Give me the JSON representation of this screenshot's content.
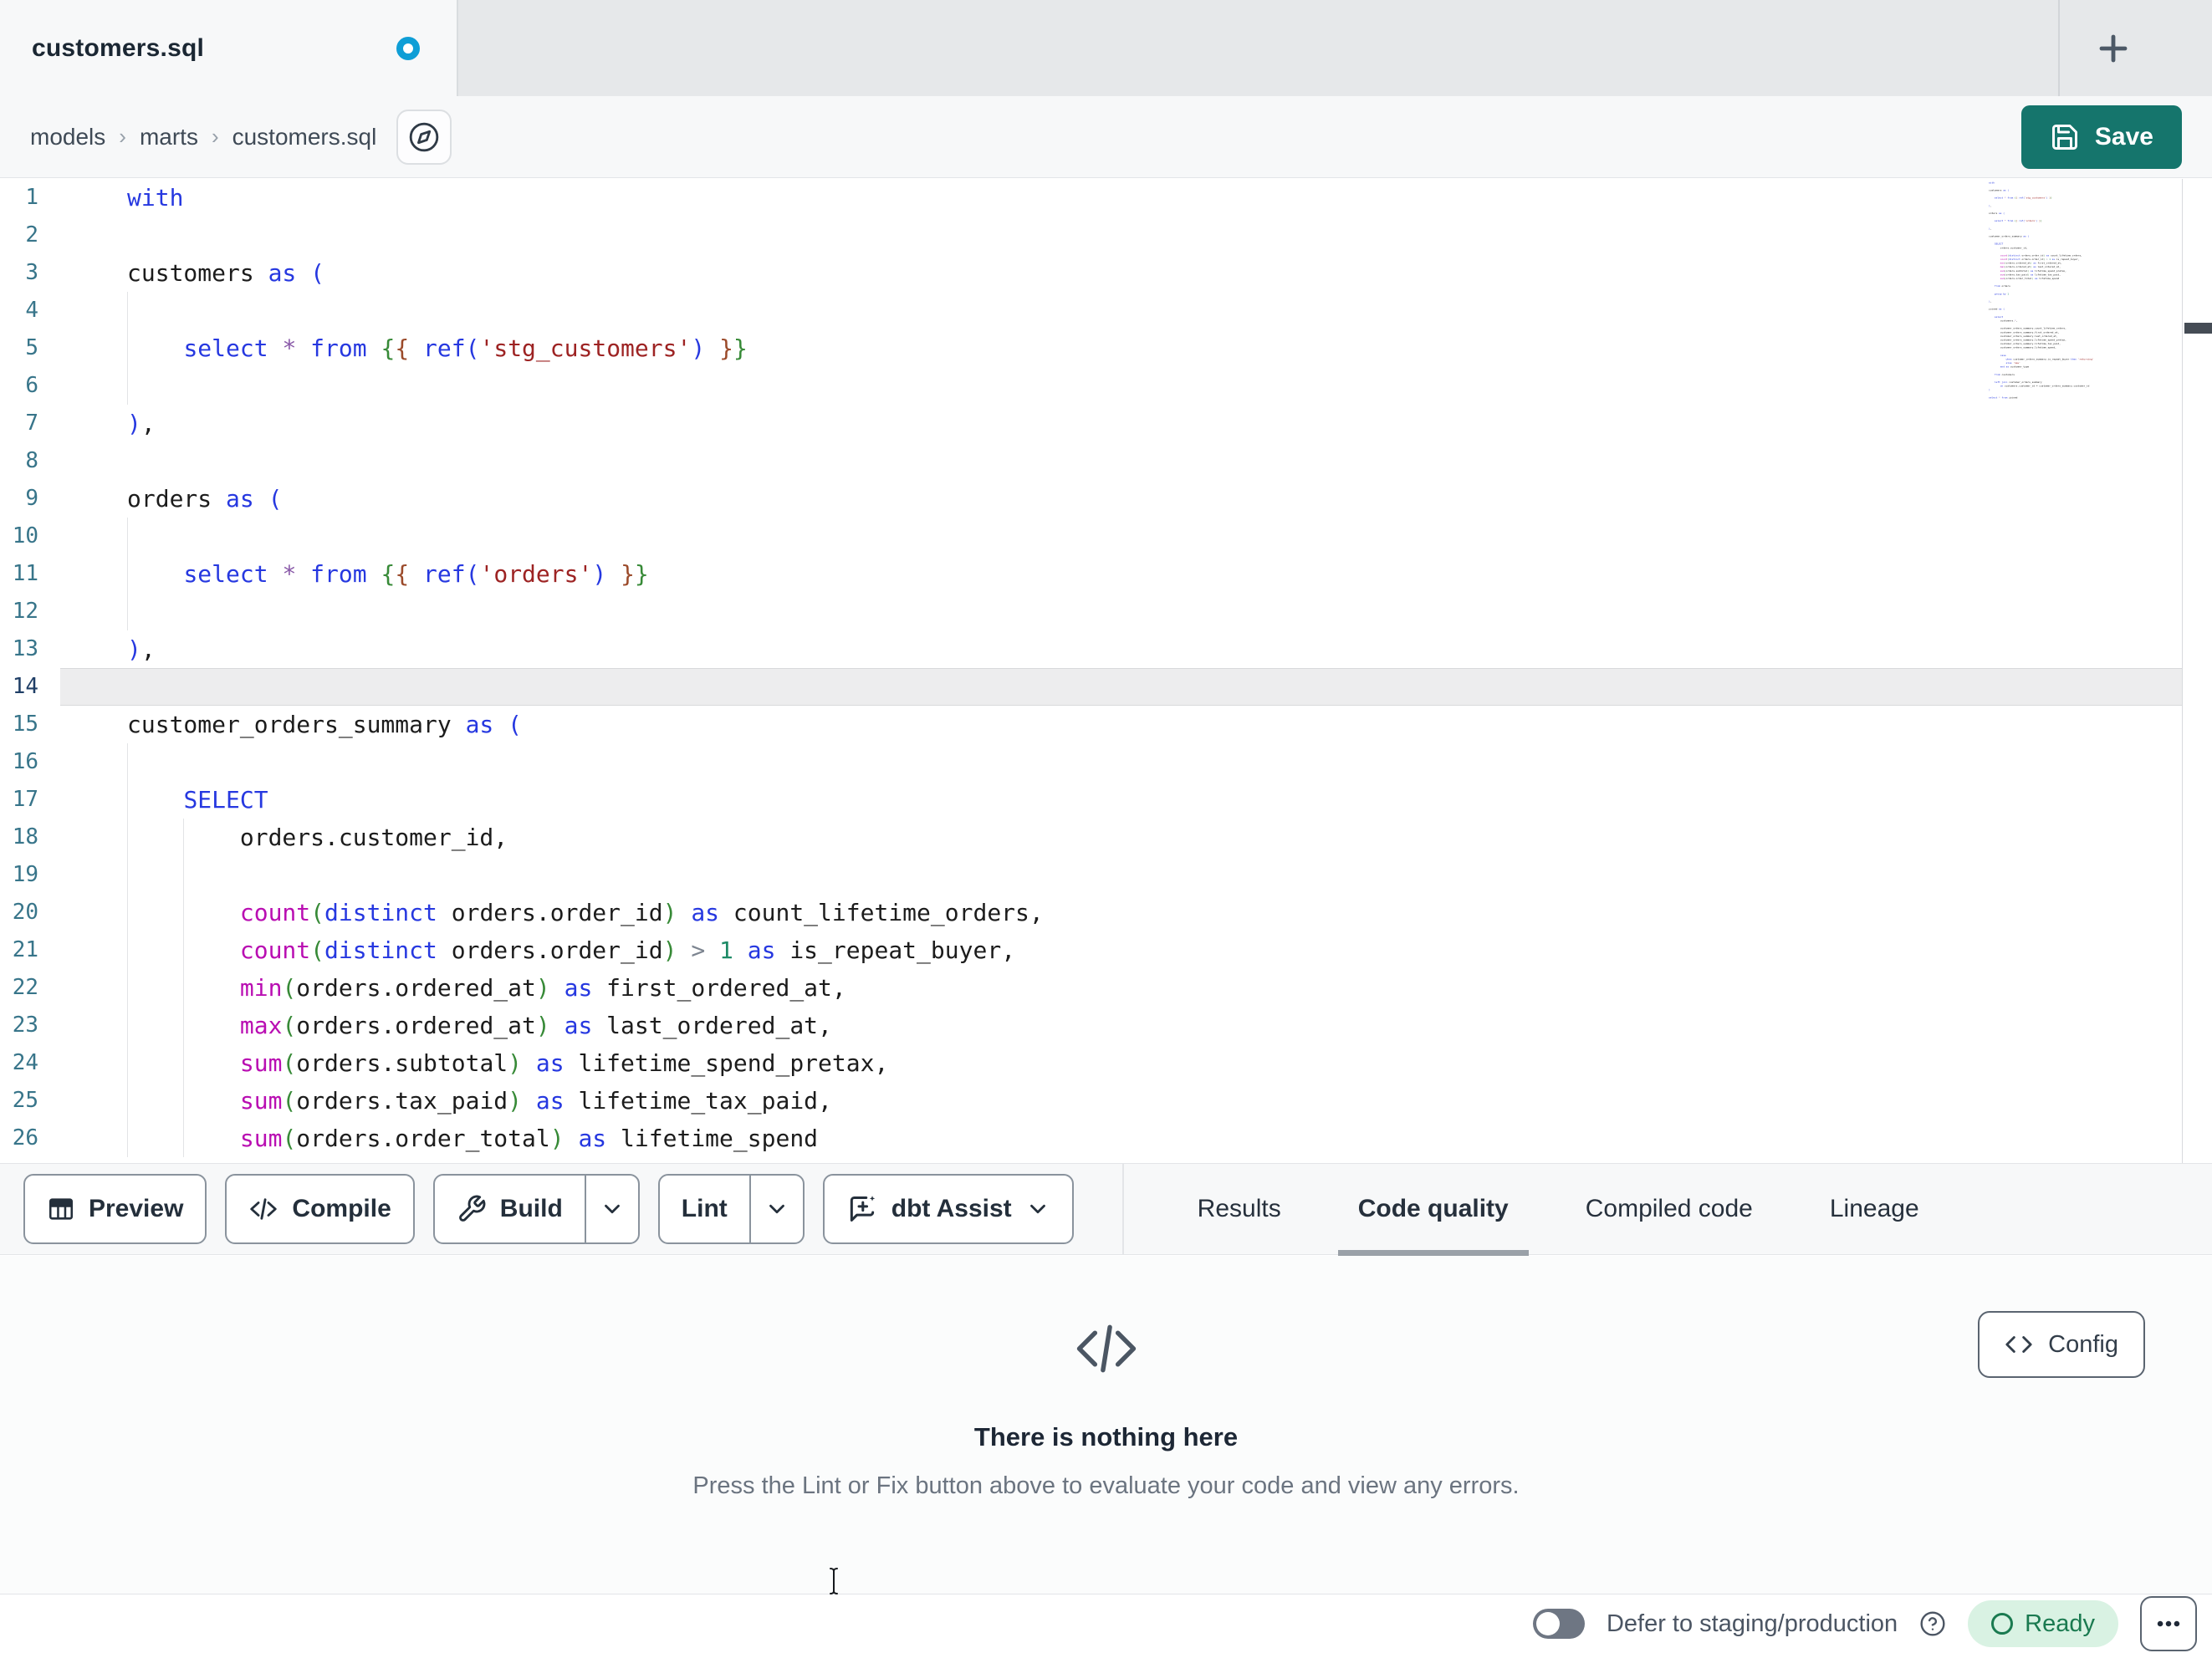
{
  "tab_bar": {
    "active_tab": {
      "title": "customers.sql",
      "unsaved": true,
      "unsaved_icon": "unsaved-dot-icon"
    },
    "new_tab_icon": "plus-icon"
  },
  "breadcrumb": {
    "items": [
      "models",
      "marts",
      "customers.sql"
    ],
    "separator": "›",
    "action_icon": "compass-icon"
  },
  "header": {
    "save_label": "Save",
    "save_icon": "save-icon"
  },
  "editor": {
    "active_line": 14,
    "lines": [
      {
        "n": 1,
        "seg": [
          [
            "kw",
            "with"
          ]
        ]
      },
      {
        "n": 2,
        "seg": []
      },
      {
        "n": 3,
        "seg": [
          [
            "txt",
            "customers "
          ],
          [
            "kw",
            "as"
          ],
          [
            "txt",
            " "
          ],
          [
            "b1",
            "("
          ]
        ]
      },
      {
        "n": 4,
        "seg": [],
        "g": [
          0
        ]
      },
      {
        "n": 5,
        "g": [
          0
        ],
        "seg": [
          [
            "txt",
            "    "
          ],
          [
            "kw",
            "select"
          ],
          [
            "txt",
            " "
          ],
          [
            "star",
            "*"
          ],
          [
            "txt",
            " "
          ],
          [
            "kw",
            "from"
          ],
          [
            "txt",
            " "
          ],
          [
            "b2",
            "{"
          ],
          [
            "b3",
            "{"
          ],
          [
            "txt",
            " "
          ],
          [
            "kw",
            "ref"
          ],
          [
            "b1",
            "("
          ],
          [
            "str",
            "'stg_customers'"
          ],
          [
            "b1",
            ")"
          ],
          [
            "txt",
            " "
          ],
          [
            "b3",
            "}"
          ],
          [
            "b2",
            "}"
          ]
        ]
      },
      {
        "n": 6,
        "seg": [],
        "g": [
          0
        ]
      },
      {
        "n": 7,
        "seg": [
          [
            "b1",
            ")"
          ],
          [
            "txt",
            ","
          ]
        ]
      },
      {
        "n": 8,
        "seg": []
      },
      {
        "n": 9,
        "seg": [
          [
            "txt",
            "orders "
          ],
          [
            "kw",
            "as"
          ],
          [
            "txt",
            " "
          ],
          [
            "b1",
            "("
          ]
        ]
      },
      {
        "n": 10,
        "seg": [],
        "g": [
          0
        ]
      },
      {
        "n": 11,
        "g": [
          0
        ],
        "seg": [
          [
            "txt",
            "    "
          ],
          [
            "kw",
            "select"
          ],
          [
            "txt",
            " "
          ],
          [
            "star",
            "*"
          ],
          [
            "txt",
            " "
          ],
          [
            "kw",
            "from"
          ],
          [
            "txt",
            " "
          ],
          [
            "b2",
            "{"
          ],
          [
            "b3",
            "{"
          ],
          [
            "txt",
            " "
          ],
          [
            "kw",
            "ref"
          ],
          [
            "b1",
            "("
          ],
          [
            "str",
            "'orders'"
          ],
          [
            "b1",
            ")"
          ],
          [
            "txt",
            " "
          ],
          [
            "b3",
            "}"
          ],
          [
            "b2",
            "}"
          ]
        ]
      },
      {
        "n": 12,
        "seg": [],
        "g": [
          0
        ]
      },
      {
        "n": 13,
        "seg": [
          [
            "b1",
            ")"
          ],
          [
            "txt",
            ","
          ]
        ]
      },
      {
        "n": 14,
        "seg": []
      },
      {
        "n": 15,
        "seg": [
          [
            "txt",
            "customer_orders_summary "
          ],
          [
            "kw",
            "as"
          ],
          [
            "txt",
            " "
          ],
          [
            "b1",
            "("
          ]
        ]
      },
      {
        "n": 16,
        "seg": [],
        "g": [
          0
        ]
      },
      {
        "n": 17,
        "g": [
          0
        ],
        "seg": [
          [
            "txt",
            "    "
          ],
          [
            "kw",
            "SELECT"
          ]
        ]
      },
      {
        "n": 18,
        "g": [
          0,
          1
        ],
        "seg": [
          [
            "txt",
            "        orders.customer_id,"
          ]
        ]
      },
      {
        "n": 19,
        "seg": [],
        "g": [
          0,
          1
        ]
      },
      {
        "n": 20,
        "g": [
          0,
          1
        ],
        "seg": [
          [
            "txt",
            "        "
          ],
          [
            "fn",
            "count"
          ],
          [
            "b2",
            "("
          ],
          [
            "kw",
            "distinct"
          ],
          [
            "txt",
            " orders.order_id"
          ],
          [
            "b2",
            ")"
          ],
          [
            "txt",
            " "
          ],
          [
            "kw",
            "as"
          ],
          [
            "txt",
            " count_lifetime_orders,"
          ]
        ]
      },
      {
        "n": 21,
        "g": [
          0,
          1
        ],
        "seg": [
          [
            "txt",
            "        "
          ],
          [
            "fn",
            "count"
          ],
          [
            "b2",
            "("
          ],
          [
            "kw",
            "distinct"
          ],
          [
            "txt",
            " orders.order_id"
          ],
          [
            "b2",
            ")"
          ],
          [
            "txt",
            " "
          ],
          [
            "op",
            ">"
          ],
          [
            "txt",
            " "
          ],
          [
            "num",
            "1"
          ],
          [
            "txt",
            " "
          ],
          [
            "kw",
            "as"
          ],
          [
            "txt",
            " is_repeat_buyer,"
          ]
        ]
      },
      {
        "n": 22,
        "g": [
          0,
          1
        ],
        "seg": [
          [
            "txt",
            "        "
          ],
          [
            "fn",
            "min"
          ],
          [
            "b2",
            "("
          ],
          [
            "txt",
            "orders.ordered_at"
          ],
          [
            "b2",
            ")"
          ],
          [
            "txt",
            " "
          ],
          [
            "kw",
            "as"
          ],
          [
            "txt",
            " first_ordered_at,"
          ]
        ]
      },
      {
        "n": 23,
        "g": [
          0,
          1
        ],
        "seg": [
          [
            "txt",
            "        "
          ],
          [
            "fn",
            "max"
          ],
          [
            "b2",
            "("
          ],
          [
            "txt",
            "orders.ordered_at"
          ],
          [
            "b2",
            ")"
          ],
          [
            "txt",
            " "
          ],
          [
            "kw",
            "as"
          ],
          [
            "txt",
            " last_ordered_at,"
          ]
        ]
      },
      {
        "n": 24,
        "g": [
          0,
          1
        ],
        "seg": [
          [
            "txt",
            "        "
          ],
          [
            "fn",
            "sum"
          ],
          [
            "b2",
            "("
          ],
          [
            "txt",
            "orders.subtotal"
          ],
          [
            "b2",
            ")"
          ],
          [
            "txt",
            " "
          ],
          [
            "kw",
            "as"
          ],
          [
            "txt",
            " lifetime_spend_pretax,"
          ]
        ]
      },
      {
        "n": 25,
        "g": [
          0,
          1
        ],
        "seg": [
          [
            "txt",
            "        "
          ],
          [
            "fn",
            "sum"
          ],
          [
            "b2",
            "("
          ],
          [
            "txt",
            "orders.tax_paid"
          ],
          [
            "b2",
            ")"
          ],
          [
            "txt",
            " "
          ],
          [
            "kw",
            "as"
          ],
          [
            "txt",
            " lifetime_tax_paid,"
          ]
        ]
      },
      {
        "n": 26,
        "g": [
          0,
          1
        ],
        "seg": [
          [
            "txt",
            "        "
          ],
          [
            "fn",
            "sum"
          ],
          [
            "b2",
            "("
          ],
          [
            "txt",
            "orders.order_total"
          ],
          [
            "b2",
            ")"
          ],
          [
            "txt",
            " "
          ],
          [
            "kw",
            "as"
          ],
          [
            "txt",
            " lifetime_spend"
          ]
        ]
      }
    ]
  },
  "minimap_extra_lines": [
    [],
    [
      [
        "txt",
        "    "
      ],
      [
        "kw",
        "from"
      ],
      [
        "txt",
        " orders"
      ]
    ],
    [],
    [
      [
        "txt",
        "    "
      ],
      [
        "kw",
        "group"
      ],
      [
        "txt",
        " "
      ],
      [
        "kw",
        "by"
      ],
      [
        "txt",
        " "
      ],
      [
        "num",
        "1"
      ]
    ],
    [],
    [
      [
        "b1",
        ")"
      ],
      [
        "txt",
        ","
      ]
    ],
    [],
    [
      [
        "txt",
        "joined "
      ],
      [
        "kw",
        "as"
      ],
      [
        "txt",
        " "
      ],
      [
        "b1",
        "("
      ]
    ],
    [],
    [
      [
        "txt",
        "    "
      ],
      [
        "kw",
        "select"
      ]
    ],
    [
      [
        "txt",
        "        customers."
      ],
      [
        "star",
        "*"
      ],
      [
        "txt",
        ","
      ]
    ],
    [],
    [
      [
        "txt",
        "        customer_orders_summary.count_lifetime_orders,"
      ]
    ],
    [
      [
        "txt",
        "        customer_orders_summary.first_ordered_at,"
      ]
    ],
    [
      [
        "txt",
        "        customer_orders_summary.last_ordered_at,"
      ]
    ],
    [
      [
        "txt",
        "        customer_orders_summary.lifetime_spend_pretax,"
      ]
    ],
    [
      [
        "txt",
        "        customer_orders_summary.lifetime_tax_paid,"
      ]
    ],
    [
      [
        "txt",
        "        customer_orders_summary.lifetime_spend,"
      ]
    ],
    [],
    [
      [
        "txt",
        "        "
      ],
      [
        "kw",
        "case"
      ]
    ],
    [
      [
        "txt",
        "            "
      ],
      [
        "kw",
        "when"
      ],
      [
        "txt",
        " customer_orders_summary.is_repeat_buyer "
      ],
      [
        "kw",
        "then"
      ],
      [
        "txt",
        " "
      ],
      [
        "str",
        "'returning'"
      ]
    ],
    [
      [
        "txt",
        "            "
      ],
      [
        "kw",
        "else"
      ],
      [
        "txt",
        " "
      ],
      [
        "str",
        "'new'"
      ]
    ],
    [
      [
        "txt",
        "        "
      ],
      [
        "kw",
        "end"
      ],
      [
        "txt",
        " "
      ],
      [
        "kw",
        "as"
      ],
      [
        "txt",
        " customer_type"
      ]
    ],
    [],
    [
      [
        "txt",
        "    "
      ],
      [
        "kw",
        "from"
      ],
      [
        "txt",
        " customers"
      ]
    ],
    [],
    [
      [
        "txt",
        "    "
      ],
      [
        "kw",
        "left"
      ],
      [
        "txt",
        " "
      ],
      [
        "kw",
        "join"
      ],
      [
        "txt",
        " customer_orders_summary"
      ]
    ],
    [
      [
        "txt",
        "        "
      ],
      [
        "kw",
        "on"
      ],
      [
        "txt",
        " customers.customer_id = customer_orders_summary.customer_id"
      ]
    ],
    [
      [
        "b1",
        ")"
      ]
    ],
    [],
    [
      [
        "kw",
        "select"
      ],
      [
        "txt",
        " "
      ],
      [
        "star",
        "*"
      ],
      [
        "txt",
        " "
      ],
      [
        "kw",
        "from"
      ],
      [
        "txt",
        " joined"
      ]
    ]
  ],
  "toolbar": {
    "buttons": [
      {
        "label": "Preview",
        "icon": "table-icon"
      },
      {
        "label": "Compile",
        "icon": "code-slash-icon"
      },
      {
        "label": "Build",
        "icon": "wrench-icon",
        "split": true
      },
      {
        "label": "Lint",
        "split": true
      },
      {
        "label": "dbt Assist",
        "icon": "assist-icon",
        "chevron": true
      }
    ]
  },
  "panel_tabs": [
    {
      "label": "Results"
    },
    {
      "label": "Code quality",
      "active": true
    },
    {
      "label": "Compiled code"
    },
    {
      "label": "Lineage"
    }
  ],
  "empty_state": {
    "icon": "code-icon",
    "title": "There is nothing here",
    "description": "Press the Lint or Fix button above to evaluate your code and view any errors.",
    "config_label": "Config",
    "config_icon": "code-icon"
  },
  "status_bar": {
    "defer_toggle_on": false,
    "defer_label": "Defer to staging/production",
    "help_icon": "help-circle-icon",
    "ready_label": "Ready",
    "more_icon": "ellipsis-icon"
  },
  "colors": {
    "accent_save": "#15756c",
    "unsaved_dot": "#0f9ed6",
    "ready_bg": "#d9f2e3",
    "ready_fg": "#1a7a50",
    "active_line_bg": "#ededee",
    "syntax": {
      "kw": "#2638e0",
      "fn": "#b90eb2",
      "str": "#9d2323",
      "b1": "#2638e0",
      "b2": "#378a37",
      "b3": "#9b4a2a",
      "num": "#1d8a66",
      "op": "#7d8590",
      "star": "#8959a8",
      "txt": "#1c1c1c",
      "ln": "#38758a",
      "ln_active": "#1f3e66"
    }
  }
}
